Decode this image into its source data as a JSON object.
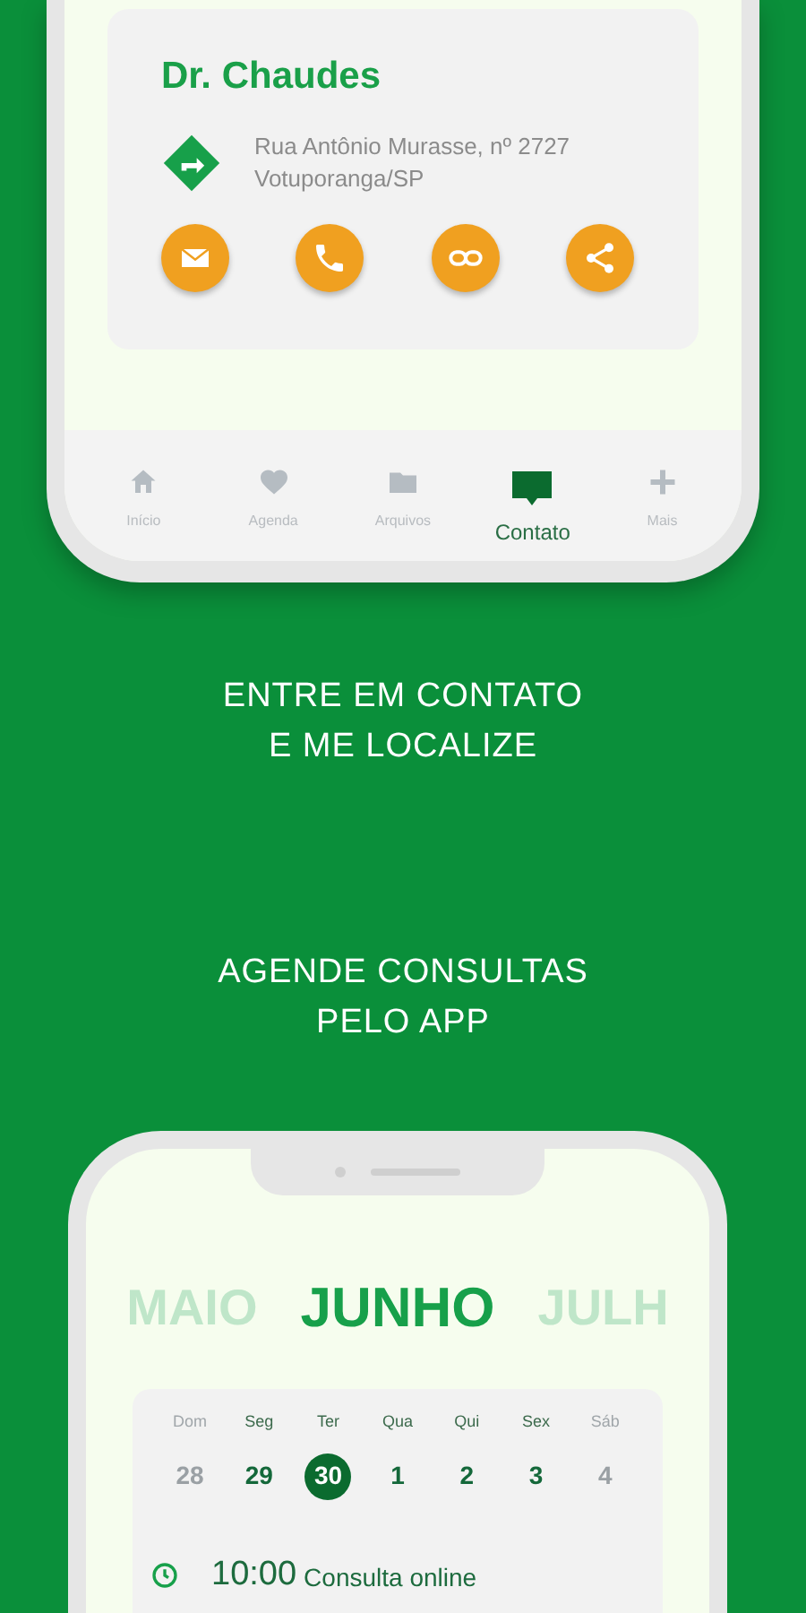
{
  "contact_card": {
    "name": "Dr. Chaudes",
    "address_lines": [
      "Rua Antônio Murasse, nº 2727",
      "Votuporanga/SP"
    ],
    "actions": [
      {
        "kind": "email"
      },
      {
        "kind": "phone"
      },
      {
        "kind": "link"
      },
      {
        "kind": "share"
      }
    ]
  },
  "bottom_nav": [
    {
      "label": "Início",
      "kind": "home",
      "selected": false
    },
    {
      "label": "Agenda",
      "kind": "heart",
      "selected": false
    },
    {
      "label": "Arquivos",
      "kind": "folder",
      "selected": false
    },
    {
      "label": "Contato",
      "kind": "chat",
      "selected": true
    },
    {
      "label": "Mais",
      "kind": "plus",
      "selected": false
    }
  ],
  "caption_1": [
    "ENTRE EM CONTATO",
    "E ME LOCALIZE"
  ],
  "caption_2": [
    "AGENDE CONSULTAS",
    "PELO APP"
  ],
  "months": [
    {
      "label": "MAIO",
      "selected": false
    },
    {
      "label": "JUNHO",
      "selected": true
    },
    {
      "label": "JULH",
      "selected": false
    }
  ],
  "calendar": {
    "days": [
      {
        "weekday": "Dom",
        "date": "28",
        "muted": true,
        "selected": false
      },
      {
        "weekday": "Seg",
        "date": "29",
        "muted": false,
        "selected": false
      },
      {
        "weekday": "Ter",
        "date": "30",
        "muted": false,
        "selected": true
      },
      {
        "weekday": "Qua",
        "date": "1",
        "muted": false,
        "selected": false
      },
      {
        "weekday": "Qui",
        "date": "2",
        "muted": false,
        "selected": false
      },
      {
        "weekday": "Sex",
        "date": "3",
        "muted": false,
        "selected": false
      },
      {
        "weekday": "Sáb",
        "date": "4",
        "muted": true,
        "selected": false
      }
    ],
    "event": {
      "time": "10:00",
      "title": "Consulta online"
    }
  }
}
